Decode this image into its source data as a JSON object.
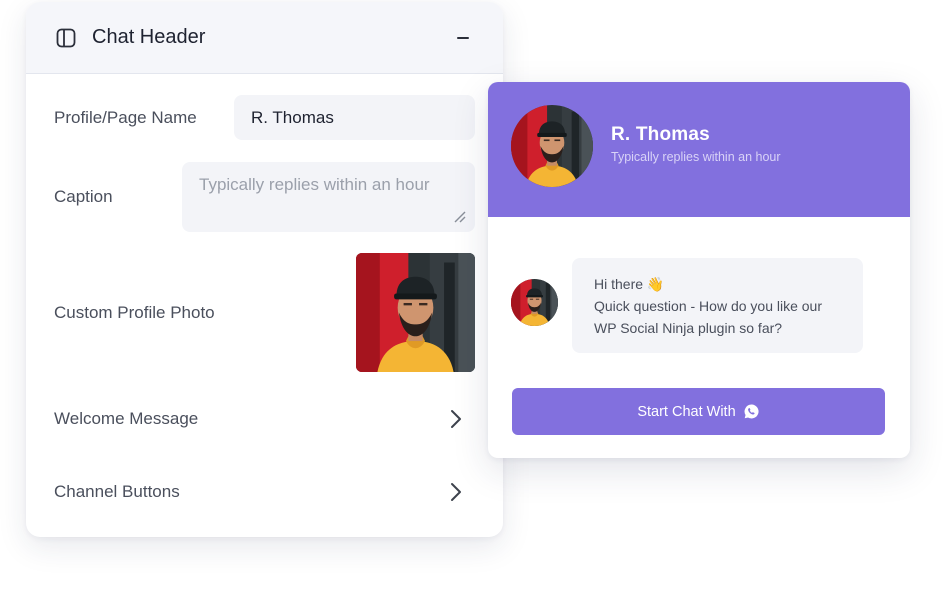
{
  "settings": {
    "section_title": "Chat Header",
    "profile_name_label": "Profile/Page Name",
    "profile_name_value": "R. Thomas",
    "caption_label": "Caption",
    "caption_placeholder": "Typically replies within an hour",
    "photo_label": "Custom Profile Photo",
    "welcome_message_label": "Welcome Message",
    "channel_buttons_label": "Channel Buttons"
  },
  "preview": {
    "name": "R. Thomas",
    "caption": "Typically replies within an hour",
    "message": {
      "line1": "Hi there 👋",
      "line2": "Quick question - How do you like our",
      "line3": "WP Social Ninja plugin so far?"
    },
    "start_chat_label": "Start Chat With"
  },
  "colors": {
    "accent": "#8270de",
    "panel_header_bg": "#f5f6fa",
    "input_bg": "#f3f4f8"
  },
  "icons": {
    "panel": "sidebar-panel-icon",
    "collapse": "minus-icon",
    "chevron": "chevron-right-icon",
    "resize": "resize-grip-icon",
    "whatsapp": "whatsapp-icon"
  }
}
